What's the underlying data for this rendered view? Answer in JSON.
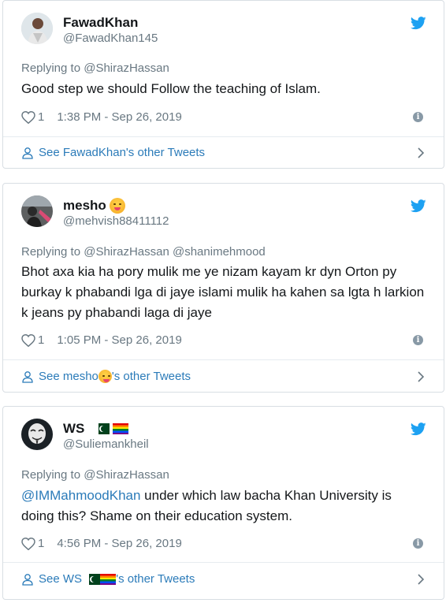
{
  "tweets": [
    {
      "display_name": "FawadKhan",
      "handle": "@FawadKhan145",
      "replying_prefix": "Replying to ",
      "replying_to": "@ShirazHassan",
      "text": "Good step we should Follow the teaching of Islam.",
      "likes": "1",
      "timestamp": "1:38 PM - Sep 26, 2019",
      "footer_prefix": "See FawadKhan's other Tweets",
      "avatar_icon": "person-photo-icon"
    },
    {
      "display_name": "mesho",
      "handle": "@mehvish88411112",
      "replying_prefix": "Replying to ",
      "replying_to": "@ShirazHassan @shanimehmood",
      "text": "Bhot axa kia ha pory mulik me ye nizam kayam kr dyn Orton py burkay k phabandi lga di jaye islami mulik ha kahen sa lgta h larkion k jeans py phabandi laga di jaye",
      "likes": "1",
      "timestamp": "1:05 PM - Sep 26, 2019",
      "footer_before": "See mesho",
      "footer_after": "'s other Tweets",
      "name_emoji": "face-savoring-food-emoji"
    },
    {
      "display_name": "WS",
      "handle": "@Suliemankheil",
      "replying_prefix": "Replying to ",
      "replying_to": "@ShirazHassan",
      "text_link": "@IMMahmoodKhan",
      "text": " under which law bacha Khan University is doing this? Shame on their education system.",
      "likes": "1",
      "timestamp": "4:56 PM - Sep 26, 2019",
      "footer_before": "See WS ",
      "footer_after": "'s other Tweets",
      "name_flags": [
        "pakistan-flag",
        "rainbow-flag"
      ]
    }
  ],
  "colors": {
    "link": "#2b7bb9",
    "muted": "#697882",
    "twitter_blue": "#1da1f2",
    "border": "#d8dee3"
  }
}
